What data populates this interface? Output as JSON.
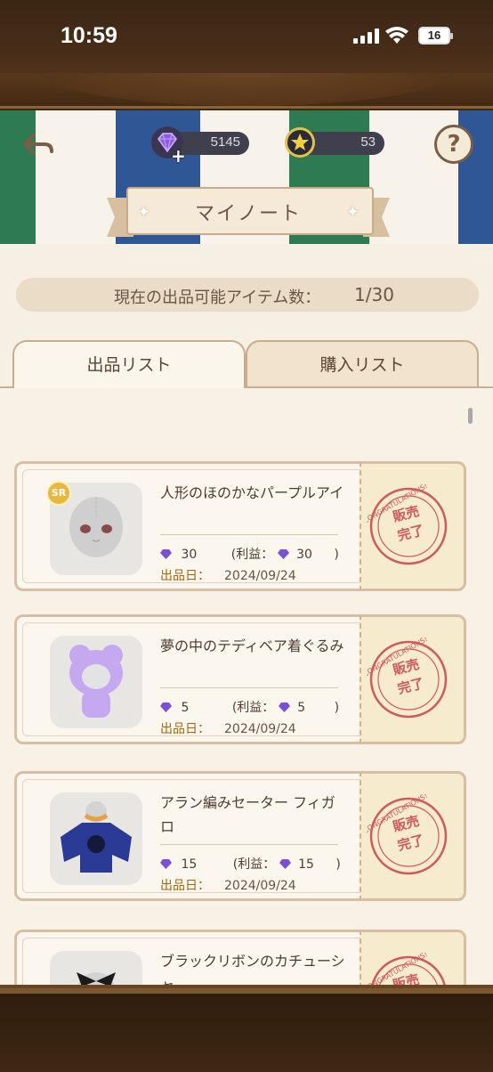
{
  "status": {
    "time": "10:59",
    "battery": "16"
  },
  "header": {
    "gems": "5145",
    "plus": "+",
    "stars": "53",
    "title": "マイノート",
    "help": "?"
  },
  "count": {
    "label": "現在の出品可能アイテム数：",
    "value": "1/30"
  },
  "tabs": [
    {
      "label": "出品リスト",
      "active": true
    },
    {
      "label": "購入リスト",
      "active": false
    }
  ],
  "items": [
    {
      "name": "人形のほのかなパープルアイ",
      "badge": "SR",
      "price": "30",
      "profit_label": "(利益：",
      "profit": "30",
      "close": ")",
      "date_label": "出品日：",
      "date": "2024/09/24",
      "stamp": "販売\n完了"
    },
    {
      "name": "夢の中のテディベア着ぐるみ",
      "badge": "",
      "price": "5",
      "profit_label": "(利益：",
      "profit": "5",
      "close": ")",
      "date_label": "出品日：",
      "date": "2024/09/24",
      "stamp": "販売\n完了"
    },
    {
      "name": "アラン編みセーター フィガロ",
      "badge": "",
      "price": "15",
      "profit_label": "(利益：",
      "profit": "15",
      "close": ")",
      "date_label": "出品日：",
      "date": "2024/09/24",
      "stamp": "販売\n完了"
    },
    {
      "name": "ブラックリボンのカチューシャ",
      "badge": "",
      "price": "",
      "profit_label": "",
      "profit": "",
      "close": "",
      "date_label": "",
      "date": "",
      "stamp": "販売\n完了"
    }
  ],
  "colors": {
    "green": "#2e7a52",
    "blue": "#2f5796",
    "gem": "#7a4fd6",
    "stamp": "#cc5b5b"
  }
}
